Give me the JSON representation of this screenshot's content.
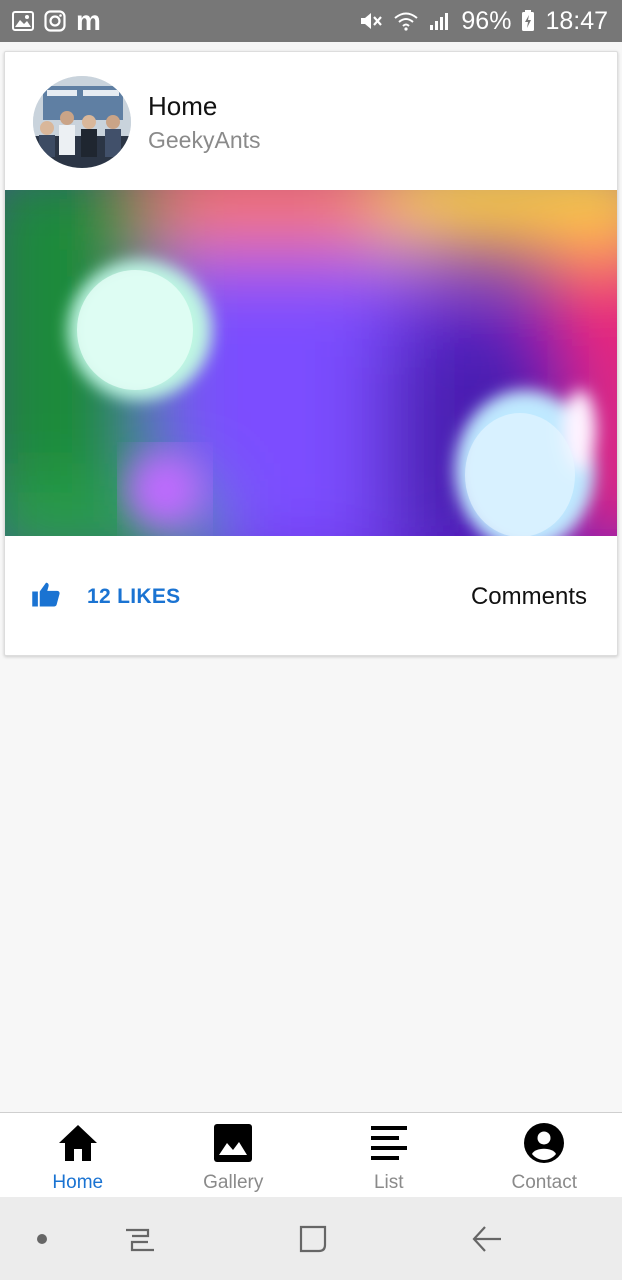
{
  "status_bar": {
    "left_icons": [
      "image-icon",
      "instagram-icon",
      "m-app-icon"
    ],
    "m_glyph": "m",
    "battery": "96%",
    "time": "18:47",
    "right_icons": [
      "mute-icon",
      "wifi-icon",
      "signal-icon",
      "battery-charging-icon"
    ]
  },
  "card": {
    "title": "Home",
    "subtitle": "GeekyAnts",
    "likes": "12 LIKES",
    "comments": "Comments",
    "accent_color": "#1a73d2"
  },
  "tabs": [
    {
      "label": "Home",
      "icon": "home-icon",
      "active": true
    },
    {
      "label": "Gallery",
      "icon": "image-icon",
      "active": false
    },
    {
      "label": "List",
      "icon": "list-icon",
      "active": false
    },
    {
      "label": "Contact",
      "icon": "account-circle-icon",
      "active": false
    }
  ],
  "nav_bar": {
    "buttons": [
      "dot-indicator",
      "recent-apps-icon",
      "home-square-icon",
      "back-icon"
    ]
  }
}
